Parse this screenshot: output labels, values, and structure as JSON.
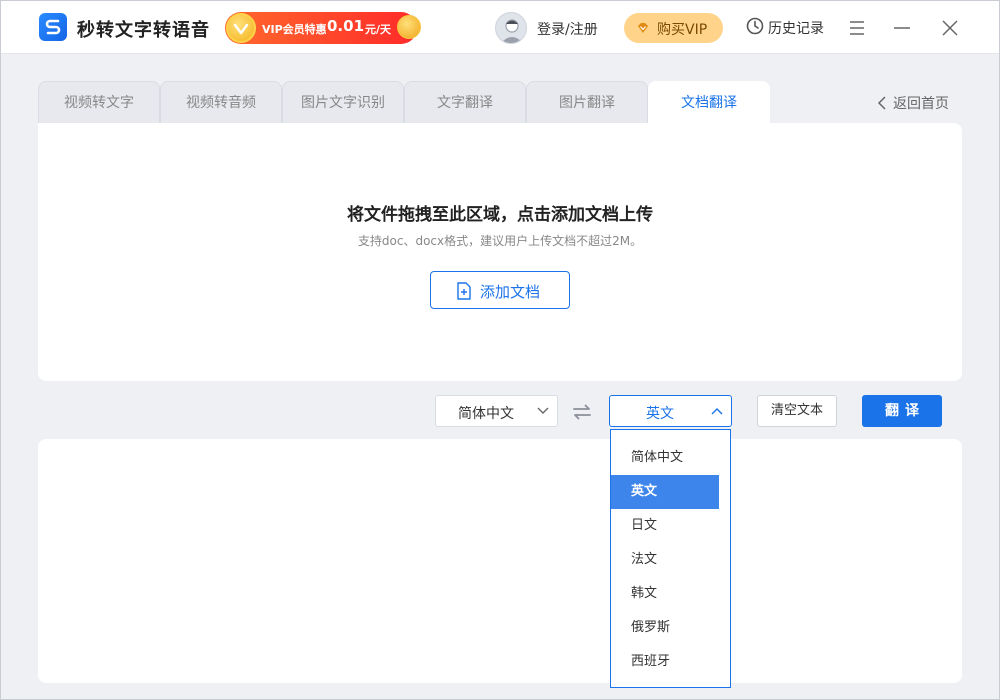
{
  "app": {
    "title": "秒转文字转语音",
    "promo": {
      "label": "VIP会员特惠",
      "price": "0.01",
      "unit": "元/天"
    },
    "login_label": "登录/注册",
    "buy_vip_label": "购买VIP",
    "history_label": "历史记录",
    "window_buttons": [
      "menu-icon",
      "minimize-icon",
      "close-icon"
    ]
  },
  "tabs": [
    {
      "label": "视频转文字",
      "active": false
    },
    {
      "label": "视频转音频",
      "active": false
    },
    {
      "label": "图片文字识别",
      "active": false
    },
    {
      "label": "文字翻译",
      "active": false
    },
    {
      "label": "图片翻译",
      "active": false
    },
    {
      "label": "文档翻译",
      "active": true
    }
  ],
  "back_home_label": "返回首页",
  "upload": {
    "title": "将文件拖拽至此区域，点击添加文档上传",
    "hint": "支持doc、docx格式，建议用户上传文档不超过2M。",
    "add_button_label": "添加文档"
  },
  "controls": {
    "source_lang": "简体中文",
    "target_lang": "英文",
    "clear_label": "清空文本",
    "translate_label": "翻译"
  },
  "dropdown": {
    "options": [
      "简体中文",
      "英文",
      "日文",
      "法文",
      "韩文",
      "俄罗斯",
      "西班牙"
    ],
    "selected": "英文"
  },
  "colors": {
    "accent": "#1a73e8",
    "background": "#eef0f4",
    "promo": "#ff3a2a",
    "vip_button": "#ffd48a"
  }
}
